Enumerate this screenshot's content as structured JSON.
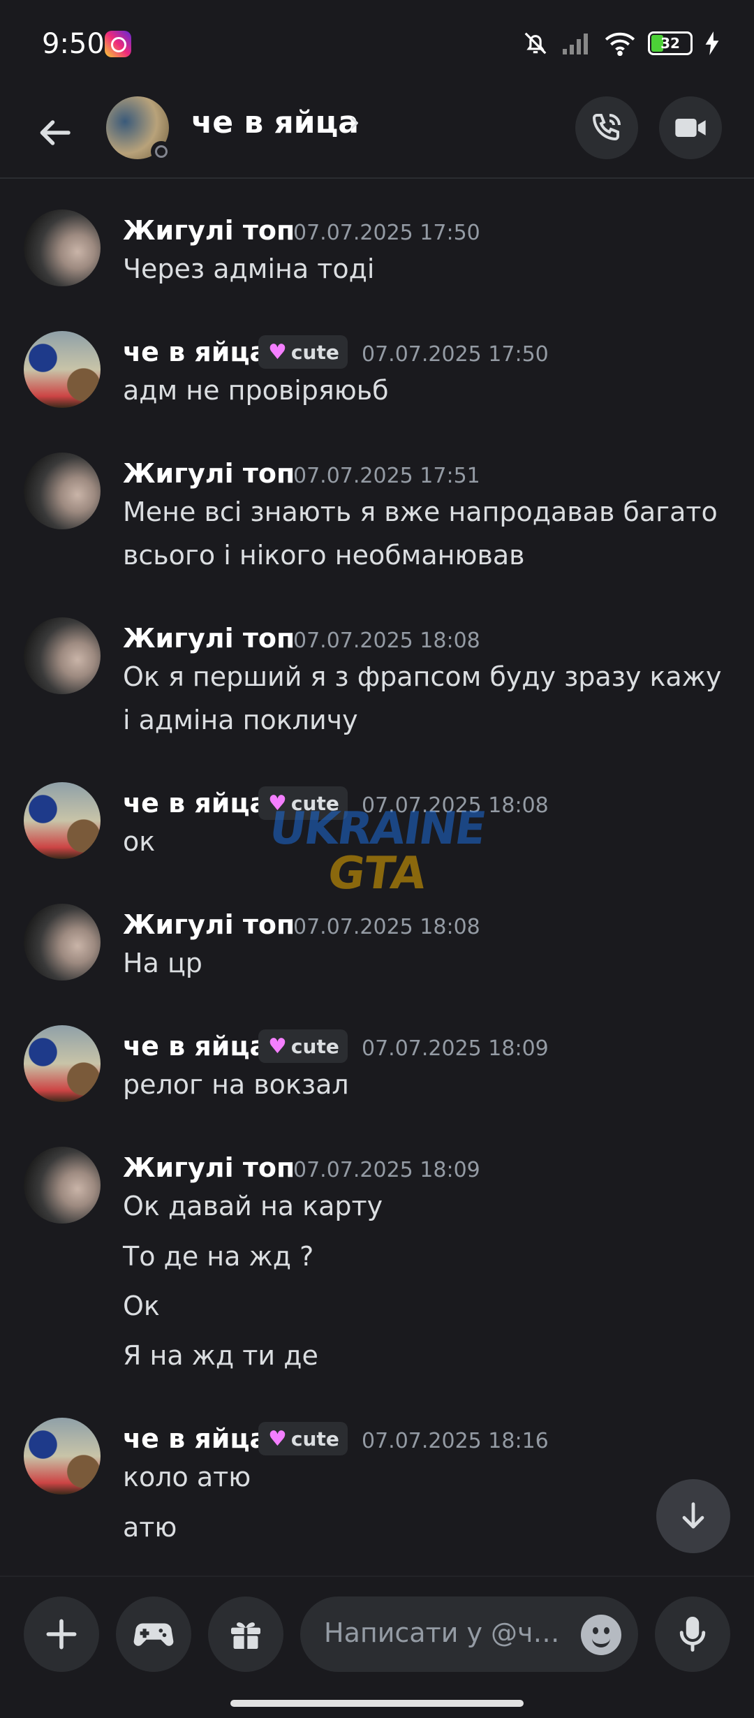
{
  "status_bar": {
    "time": "9:50",
    "battery": "32"
  },
  "header": {
    "title": "че в яйца",
    "chevron": "›"
  },
  "messages": [
    {
      "author": "Жигулі топ",
      "tag": null,
      "timestamp": "07.07.2025 17:50",
      "lines": [
        "Через адміна тоді"
      ]
    },
    {
      "author": "че в яйца",
      "tag": "cute",
      "timestamp": "07.07.2025 17:50",
      "lines": [
        "адм не провіряюьб"
      ]
    },
    {
      "author": "Жигулі топ",
      "tag": null,
      "timestamp": "07.07.2025 17:51",
      "lines": [
        "Мене всі знають я вже напродавав багато всього і нікого необманював"
      ]
    },
    {
      "author": "Жигулі топ",
      "tag": null,
      "timestamp": "07.07.2025 18:08",
      "lines": [
        "Ок я перший я з фрапсом буду зразу кажу і адміна покличу"
      ]
    },
    {
      "author": "че в яйца",
      "tag": "cute",
      "timestamp": "07.07.2025 18:08",
      "lines": [
        "ок"
      ]
    },
    {
      "author": "Жигулі топ",
      "tag": null,
      "timestamp": "07.07.2025 18:08",
      "lines": [
        "На цр"
      ]
    },
    {
      "author": "че в яйца",
      "tag": "cute",
      "timestamp": "07.07.2025 18:09",
      "lines": [
        "релог на вокзал"
      ]
    },
    {
      "author": "Жигулі топ",
      "tag": null,
      "timestamp": "07.07.2025 18:09",
      "lines": [
        "Ок давай на карту",
        "То де на жд ?",
        "Ок",
        "Я на жд ти де"
      ]
    },
    {
      "author": "че в яйца",
      "tag": "cute",
      "timestamp": "07.07.2025 18:16",
      "lines": [
        "коло атю",
        "атю"
      ]
    }
  ],
  "watermark": {
    "line1": "UKRAINE",
    "line2": "GTA"
  },
  "composer": {
    "placeholder": "Написати у @че в яйца"
  },
  "icons": {
    "back": "arrow-left-icon",
    "call": "phone-icon",
    "video": "video-camera-icon",
    "plus": "plus-icon",
    "games": "gamepad-icon",
    "gift": "gift-icon",
    "emoji": "smiley-icon",
    "mic": "microphone-icon",
    "scroll": "arrow-down-icon"
  },
  "colors": {
    "background": "#1a1a1e",
    "surface": "#2b2d31",
    "accent_tag": "#f47fff"
  }
}
